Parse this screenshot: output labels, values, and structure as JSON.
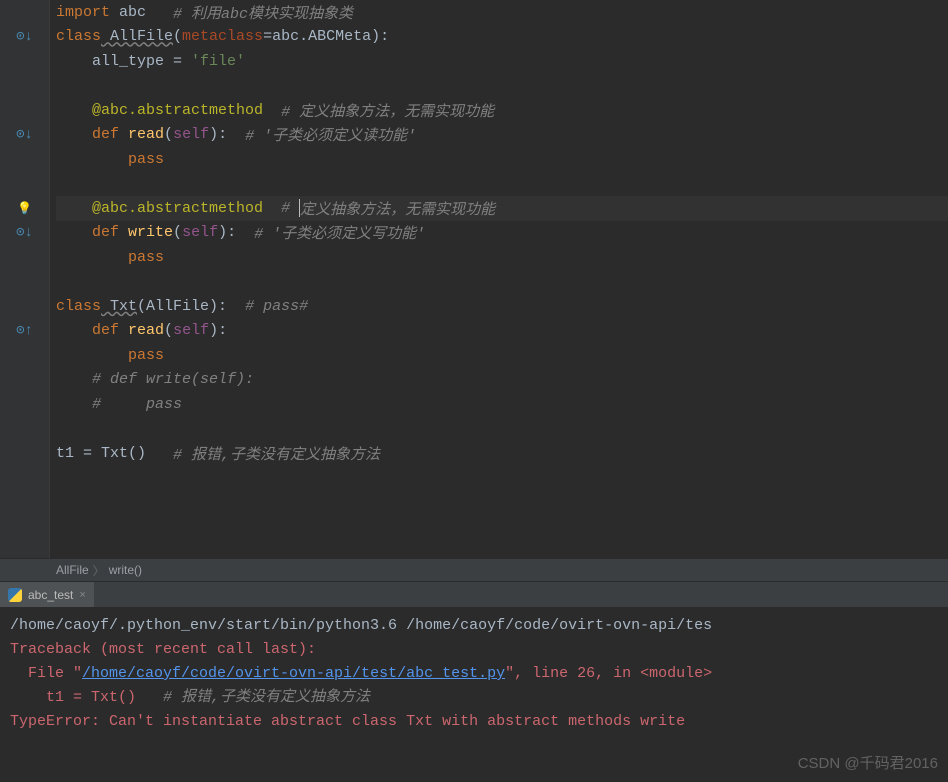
{
  "code": {
    "l1": {
      "kw1": "import",
      "mod": " abc   ",
      "c": "# 利用abc模块实现抽象类"
    },
    "l2": {
      "kw1": "class",
      "name": " AllFile",
      "p1": "(",
      "meta": "metaclass",
      "eq": "=abc.ABCMeta):"
    },
    "l3": {
      "indent": "    ",
      "attr": "all_type = ",
      "str": "'file'"
    },
    "l4": "",
    "l5": {
      "indent": "    ",
      "deco": "@abc.abstractmethod",
      "sp": "  ",
      "c": "# 定义抽象方法，无需实现功能"
    },
    "l6": {
      "indent": "    ",
      "kw": "def",
      "fn": " read",
      "p": "(",
      "self": "self",
      "p2": "):  ",
      "c": "# '子类必须定义读功能'"
    },
    "l7": {
      "indent": "        ",
      "kw": "pass"
    },
    "l8": "",
    "l9": {
      "indent": "    ",
      "deco": "@abc.abstractmethod",
      "sp": "  ",
      "c1": "# ",
      "c2": "定义抽象方法，无需实现功能"
    },
    "l10": {
      "indent": "    ",
      "kw": "def",
      "fn": " write",
      "p": "(",
      "self": "self",
      "p2": "):  ",
      "c": "# '子类必须定义写功能'"
    },
    "l11": {
      "indent": "        ",
      "kw": "pass"
    },
    "l12": "",
    "l13": {
      "kw1": "class",
      "name": " Txt",
      "p": "(AllFile):  ",
      "c": "# pass#"
    },
    "l14": {
      "indent": "    ",
      "kw": "def",
      "fn": " read",
      "p": "(",
      "self": "self",
      "p2": "):"
    },
    "l15": {
      "indent": "        ",
      "kw": "pass"
    },
    "l16": {
      "indent": "    ",
      "c": "# def write(self):"
    },
    "l17": {
      "indent": "    ",
      "c": "#     pass"
    },
    "l18": "",
    "l19": {
      "v": "t1 = Txt()   ",
      "c": "# 报错,子类没有定义抽象方法"
    }
  },
  "breadcrumb": {
    "a": "AllFile",
    "b": "write()"
  },
  "tab": {
    "name": "abc_test",
    "close": "×"
  },
  "console": {
    "l1": "/home/caoyf/.python_env/start/bin/python3.6 /home/caoyf/code/ovirt-ovn-api/tes",
    "l2": "Traceback (most recent call last):",
    "l3a": "  File \"",
    "l3b": "/home/caoyf/code/ovirt-ovn-api/test/abc_test.py",
    "l3c": "\", line 26, in <module>",
    "l4a": "    t1 = Txt()   ",
    "l4b": "# 报错,子类没有定义抽象方法",
    "l5": "TypeError: Can't instantiate abstract class Txt with abstract methods write"
  },
  "watermark": "CSDN @千码君2016",
  "icons": {
    "override": "⊙↓",
    "implement": "⊙↑",
    "bulb": "💡"
  }
}
